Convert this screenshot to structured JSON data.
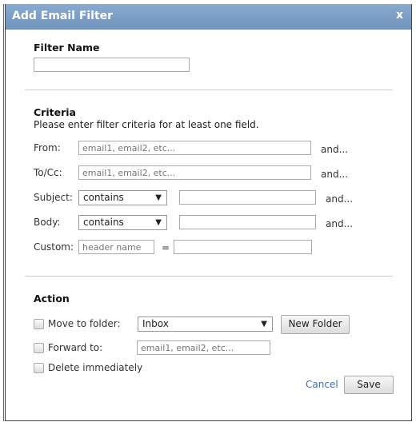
{
  "dialog": {
    "title": "Add Email Filter",
    "close_label": "x"
  },
  "filter_name": {
    "label": "Filter Name",
    "value": ""
  },
  "criteria": {
    "heading": "Criteria",
    "subtitle": "Please enter filter criteria for at least one field.",
    "from": {
      "label": "From:",
      "placeholder": "email1, email2, etc...",
      "and": "and..."
    },
    "tocc": {
      "label": "To/Cc:",
      "placeholder": "email1, email2, etc...",
      "and": "and..."
    },
    "subject": {
      "label": "Subject:",
      "operator": "contains",
      "and": "and..."
    },
    "body": {
      "label": "Body:",
      "operator": "contains",
      "and": "and..."
    },
    "custom": {
      "label": "Custom:",
      "placeholder": "header name",
      "equals": "="
    }
  },
  "action": {
    "heading": "Action",
    "move": {
      "label": "Move to folder:",
      "folder": "Inbox",
      "new_folder": "New Folder",
      "checked": false
    },
    "forward": {
      "label": "Forward to:",
      "placeholder": "email1, email2, etc...",
      "checked": false
    },
    "delete": {
      "label": "Delete immediately",
      "checked": false
    }
  },
  "footer": {
    "cancel": "Cancel",
    "save": "Save"
  },
  "icons": {
    "dropdown": "▼"
  }
}
